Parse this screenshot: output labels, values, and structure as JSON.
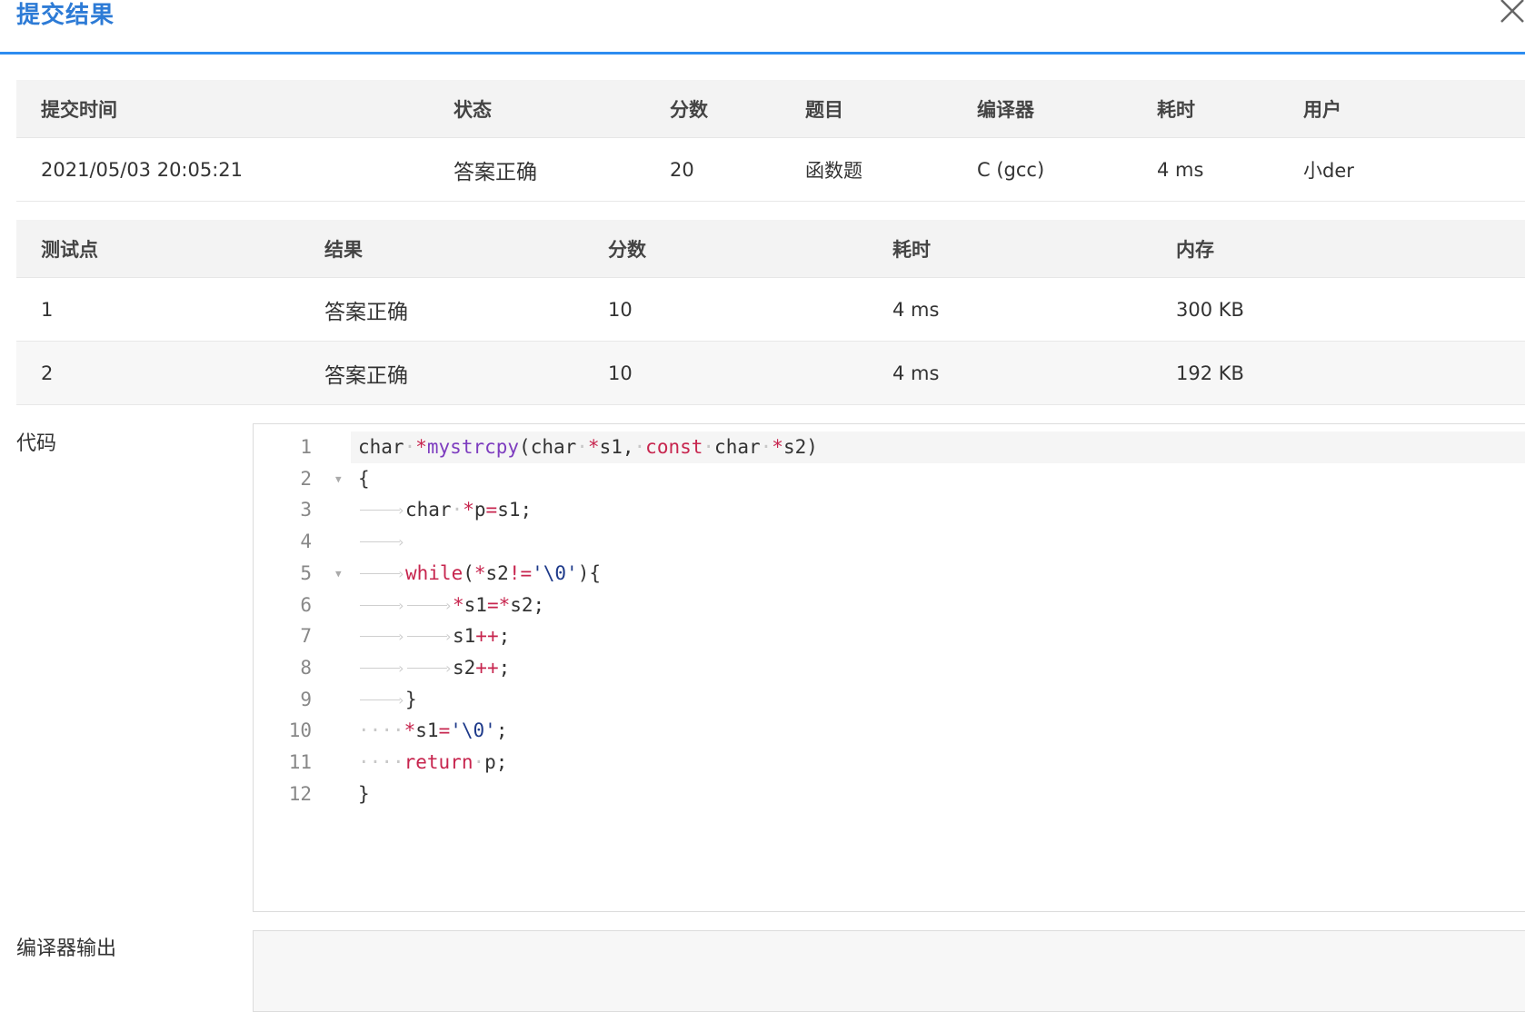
{
  "dialog": {
    "title": "提交结果"
  },
  "summary": {
    "headers": [
      "提交时间",
      "状态",
      "分数",
      "题目",
      "编译器",
      "耗时",
      "用户"
    ],
    "row": {
      "time": "2021/05/03 20:05:21",
      "status": "答案正确",
      "score": "20",
      "problem": "函数题",
      "compiler": "C (gcc)",
      "elapsed": "4 ms",
      "user": "小der"
    }
  },
  "cases": {
    "headers": [
      "测试点",
      "结果",
      "分数",
      "耗时",
      "内存"
    ],
    "rows": [
      {
        "id": "1",
        "result": "答案正确",
        "score": "10",
        "elapsed": "4 ms",
        "memory": "300 KB"
      },
      {
        "id": "2",
        "result": "答案正确",
        "score": "10",
        "elapsed": "4 ms",
        "memory": "192 KB"
      }
    ]
  },
  "code": {
    "label": "代码",
    "line_numbers": [
      "1",
      "2",
      "3",
      "4",
      "5",
      "6",
      "7",
      "8",
      "9",
      "10",
      "11",
      "12"
    ],
    "lines": [
      "char *mystrcpy(char *s1, const char *s2)",
      "{",
      "\tchar *p=s1;",
      "\t",
      "\twhile(*s2!='\\0'){",
      "\t\t*s1=*s2;",
      "\t\ts1++;",
      "\t\ts2++;",
      "\t}",
      "    *s1='\\0';",
      "    return p;",
      "}"
    ]
  },
  "compiler_output": {
    "label": "编译器输出"
  },
  "colors": {
    "accent": "#2d8cf0",
    "success": "#e74c3c"
  }
}
